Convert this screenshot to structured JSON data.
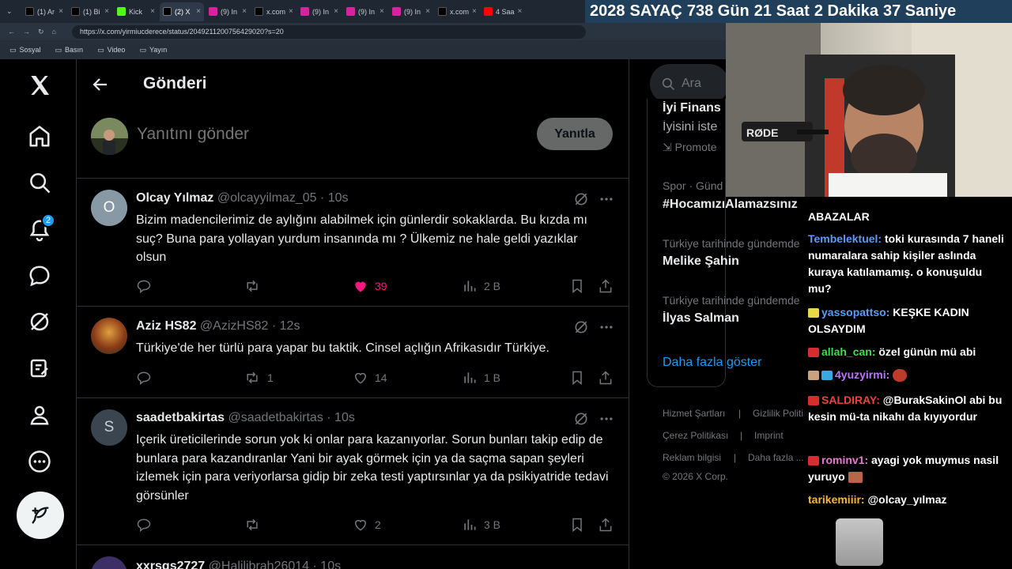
{
  "browser": {
    "tabs": [
      {
        "label": "(1) Ar",
        "fav": "x",
        "color": "#000000"
      },
      {
        "label": "(1) Bi",
        "fav": "x",
        "color": "#000000"
      },
      {
        "label": "Kick",
        "fav": "kick",
        "color": "#53fc18"
      },
      {
        "label": "(2) X",
        "fav": "x",
        "color": "#000000",
        "active": true
      },
      {
        "label": "(9) In",
        "fav": "instagram",
        "color": "#d6249f"
      },
      {
        "label": "x.com",
        "fav": "x",
        "color": "#000000"
      },
      {
        "label": "(9) In",
        "fav": "instagram",
        "color": "#d6249f"
      },
      {
        "label": "(9) In",
        "fav": "instagram",
        "color": "#d6249f"
      },
      {
        "label": "(9) In",
        "fav": "instagram",
        "color": "#d6249f"
      },
      {
        "label": "x.com",
        "fav": "x",
        "color": "#000000"
      },
      {
        "label": "4 Saa",
        "fav": "youtube",
        "color": "#ff0000"
      },
      {
        "label": "4 Saa",
        "fav": "youtube",
        "color": "#ff0000"
      }
    ],
    "url": "https://x.com/yirmiucderece/status/2049211200756429020?s=20",
    "bookmarks": [
      "Sosyal",
      "Basın",
      "Video",
      "Yayın"
    ]
  },
  "timer": {
    "year": "2028",
    "label": "SAYAÇ",
    "days": "738 Gün",
    "hours": "21 Saat",
    "minutes": "2 Dakika",
    "seconds": "37 Saniye"
  },
  "nav": {
    "notification_count": "2"
  },
  "header": {
    "title": "Gönderi"
  },
  "reply": {
    "placeholder": "Yanıtını gönder",
    "button": "Yanıtla"
  },
  "tweets": [
    {
      "name": "Olcay Yılmaz",
      "handle": "@olcayyilmaz_05",
      "time": "· 10s",
      "avatar_letter": "O",
      "avatar_color": "#8899a6",
      "text": "Bizim madencilerimiz de aylığını alabilmek için günlerdir sokaklarda. Bu kızda mı suç? Buna para yollayan yurdum insanında mı ? Ülkemiz ne hale geldi yazıklar olsun",
      "replies": "",
      "retweets": "",
      "likes": "39",
      "liked": true,
      "views": "2 B"
    },
    {
      "name": "Aziz HS82",
      "handle": "@AzizHS82",
      "time": "· 12s",
      "avatar_letter": "",
      "avatar_color": "#7a3b1c",
      "text": "Türkiye'de her türlü para yapar bu taktik. Cinsel açlığın Afrikasıdır Türkiye.",
      "replies": "",
      "retweets": "1",
      "likes": "14",
      "liked": false,
      "views": "1 B"
    },
    {
      "name": "saadetbakirtas",
      "handle": "@saadetbakirtas",
      "time": "· 10s",
      "avatar_letter": "S",
      "avatar_color": "#3a4550",
      "text": "Içerik üreticilerinde sorun yok ki onlar para kazanıyorlar. Sorun bunları takip edip de bunlara para kazandıranlar Yani bir ayak görmek için ya da saçma sapan şeyleri izlemek için para veriyorlarsa gidip bir zeka testi yaptırsınlar ya da psikiyatride tedavi görsünler",
      "replies": "",
      "retweets": "",
      "likes": "2",
      "liked": false,
      "views": "3 B"
    },
    {
      "name": "xxrsgs2727",
      "handle": "@Halilibrah26014",
      "time": "· 10s",
      "avatar_letter": "",
      "avatar_color": "#3b2f66",
      "text": "",
      "replies": "",
      "retweets": "",
      "likes": "",
      "liked": false,
      "views": ""
    }
  ],
  "sidebar": {
    "search_placeholder": "Ara",
    "ad_line1": "İyi Finans",
    "ad_line2": "İyisini iste",
    "promoted": "Promote",
    "trends": [
      {
        "context": "Spor · Günd",
        "name": "#HocamızıAlamazsınız"
      },
      {
        "context": "Türkiye tarihinde gündemde",
        "name": "Melike Şahin"
      },
      {
        "context": "Türkiye tarihinde gündemde",
        "name": "İlyas Salman"
      }
    ],
    "show_more": "Daha fazla göster",
    "footer": {
      "terms": "Hizmet Şartları",
      "privacy": "Gizlilik Politika",
      "cookies": "Çerez Politikası",
      "imprint": "Imprint",
      "ads": "Reklam bilgisi",
      "more": "Daha fazla ...",
      "copyright": "© 2026 X Corp."
    }
  },
  "chat": [
    {
      "user": "",
      "msg": "ABAZALAR",
      "user_color": "#5a9bf6"
    },
    {
      "user": "Tembelektuel:",
      "msg": "toki kurasında 7 haneli numaralara sahip kişiler aslında kuraya katılamamış. o konuşuldu mu?",
      "user_color": "#5a9bf6"
    },
    {
      "user": "yassopattso:",
      "msg": "KEŞKE KADIN OLSAYDIM",
      "user_color": "#5a9bf6"
    },
    {
      "user": "allah_can:",
      "msg": "özel günün mü abi",
      "user_color": "#3ddc55"
    },
    {
      "user": "4yuzyirmi:",
      "msg": "",
      "user_color": "#b877f2"
    },
    {
      "user": "SALDIRAY:",
      "msg": "@BurakSakinOl abi bu kesin mü-ta nikahı da kıyıyordur",
      "user_color": "#e8443a"
    },
    {
      "user": "rominv1:",
      "msg": "ayagi yok muymus nasil yuruyo",
      "user_color": "#e67ad0"
    },
    {
      "user": "tarikemiiir:",
      "msg": "@olcay_yılmaz",
      "user_color": "#f5b642"
    }
  ],
  "colors": {
    "accent": "#1d9bf0",
    "like": "#f91880",
    "bg": "#000000",
    "border": "#2f3336",
    "muted": "#71767b"
  }
}
